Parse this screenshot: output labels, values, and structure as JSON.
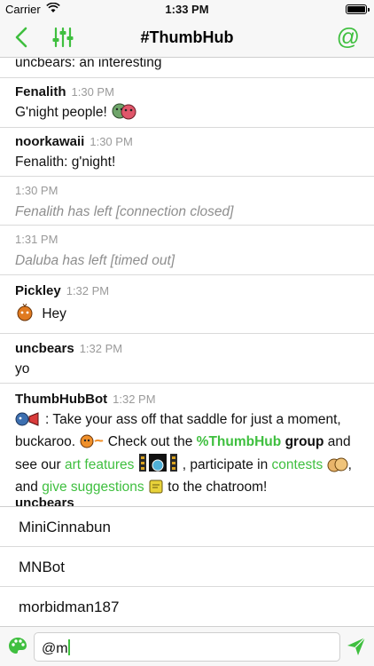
{
  "status_bar": {
    "carrier": "Carrier",
    "time": "1:33 PM"
  },
  "nav": {
    "title": "#ThumbHub",
    "mention_symbol": "@",
    "accent": "#3fbf3f"
  },
  "messages": [
    {
      "partial_text": "uncbears: an interesting"
    },
    {
      "author": "Fenalith",
      "time": "1:30 PM",
      "text": "G'night people!"
    },
    {
      "author": "noorkawaii",
      "time": "1:30 PM",
      "text": "Fenalith: g'night!"
    },
    {
      "time": "1:30 PM",
      "text": "Fenalith has left [connection closed]"
    },
    {
      "time": "1:31 PM",
      "text": "Daluba has left [timed out]"
    },
    {
      "author": "Pickley",
      "time": "1:32 PM",
      "text": "Hey"
    },
    {
      "author": "uncbears",
      "time": "1:32 PM",
      "text": "yo"
    },
    {
      "author": "ThumbHubBot",
      "time": "1:32 PM",
      "line1": ": Take your ass off that saddle for just a moment,",
      "line2_a": "buckaroo.",
      "line2_b": "Check out the",
      "group_name": "%ThumbHub",
      "group_word": "group",
      "line2_c": "and",
      "line3_a": "see our",
      "art_link": "art features",
      "line3_b": ", participate in",
      "contests_link": "contests",
      "line3_c": ",",
      "line4_a": "and",
      "suggest_link": "give suggestions",
      "line4_b": "to the chatroom!"
    },
    {
      "author": "uncbears"
    }
  ],
  "autocomplete": [
    "MiniCinnabun",
    "MNBot",
    "morbidman187"
  ],
  "input": {
    "value": "@m"
  }
}
